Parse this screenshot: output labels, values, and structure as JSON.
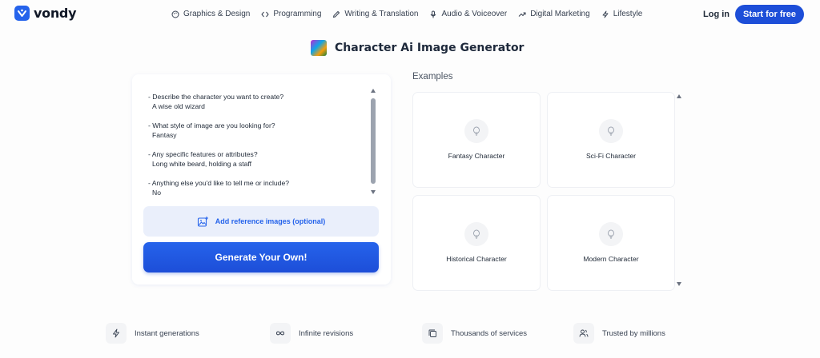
{
  "header": {
    "logo_text": "vondy",
    "nav": [
      {
        "label": "Graphics & Design",
        "icon": "palette-icon"
      },
      {
        "label": "Programming",
        "icon": "code-icon"
      },
      {
        "label": "Writing & Translation",
        "icon": "pen-icon"
      },
      {
        "label": "Audio & Voiceover",
        "icon": "microphone-icon"
      },
      {
        "label": "Digital Marketing",
        "icon": "trend-icon"
      },
      {
        "label": "Lifestyle",
        "icon": "bolt-icon"
      }
    ],
    "login_label": "Log in",
    "start_label": "Start for free"
  },
  "title": "Character Ai Image Generator",
  "prompt": [
    {
      "question": "- Describe the character you want to create?",
      "answer": "A wise old wizard"
    },
    {
      "question": "- What style of image are you looking for?",
      "answer": "Fantasy"
    },
    {
      "question": "- Any specific features or attributes?",
      "answer": "Long white beard, holding a staff"
    },
    {
      "question": "- Anything else you'd like to tell me or include?",
      "answer": "No"
    }
  ],
  "reference_label": "Add reference images (optional)",
  "generate_label": "Generate Your Own!",
  "examples": {
    "label": "Examples",
    "items": [
      {
        "label": "Fantasy Character"
      },
      {
        "label": "Sci-Fi Character"
      },
      {
        "label": "Historical Character"
      },
      {
        "label": "Modern Character"
      }
    ]
  },
  "features": [
    {
      "label": "Instant generations",
      "icon": "bolt-icon"
    },
    {
      "label": "Infinite revisions",
      "icon": "infinity-icon"
    },
    {
      "label": "Thousands of services",
      "icon": "stack-icon"
    },
    {
      "label": "Trusted by millions",
      "icon": "users-icon"
    }
  ],
  "colors": {
    "accent": "#1d4ed8",
    "accent_light": "#eaeffb",
    "text": "#1f2937"
  }
}
